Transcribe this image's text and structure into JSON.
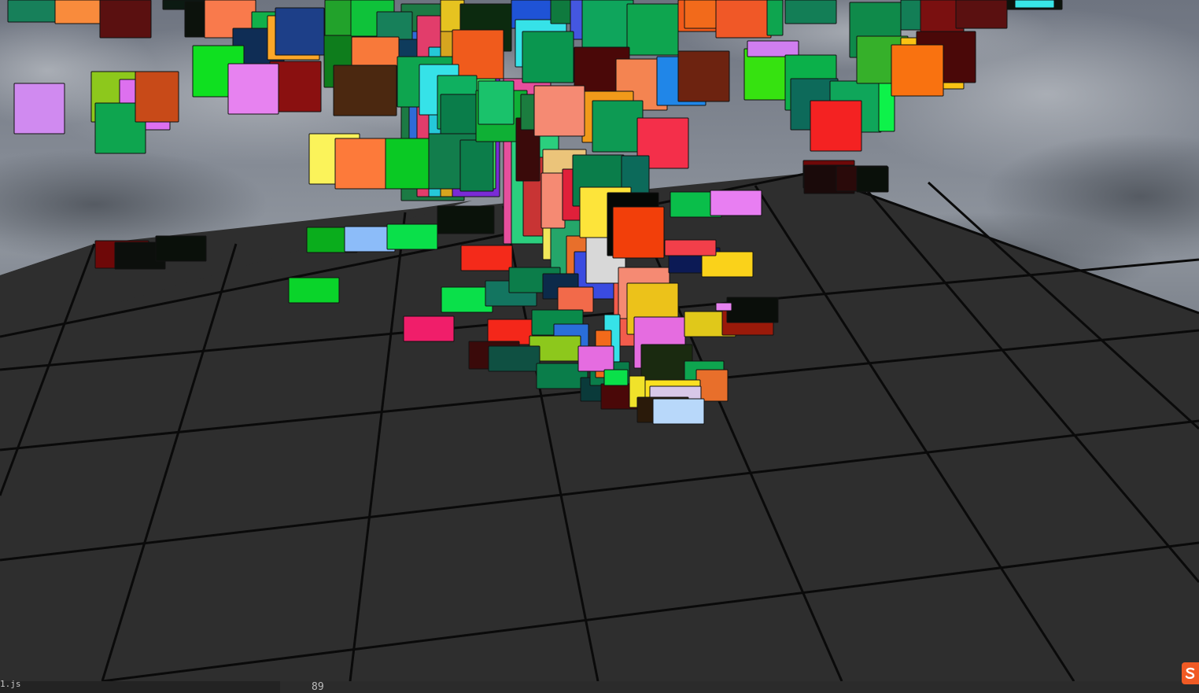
{
  "scene": {
    "sky_colors": [
      "#5d6470",
      "#7c828d",
      "#9ea3ab",
      "#6a7079"
    ],
    "floor_color": "#2e2e2e",
    "grid_line_color": "#0a0a0a",
    "box_outline_color": "#111111"
  },
  "status_bar": {
    "file_label": "1.js",
    "counter": "89"
  },
  "tray_icon": {
    "name": "sogou-ime-icon",
    "color": "#f05a24"
  }
}
